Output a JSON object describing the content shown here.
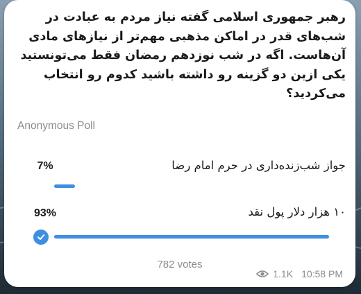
{
  "question": "رهبر جمهوری اسلامی گفته نیاز مردم به عبادت در شب‌های قدر در اماکن مذهبی مهم‌تر از نیازهای مادی آن‌هاست. اگه در شب نوزدهم رمضان فقط می‌تونستید یکی ازین دو گزینه رو داشته باشید کدوم رو انتخاب می‌کردید؟",
  "poll_type": "Anonymous Poll",
  "options": [
    {
      "percent": "7%",
      "text": "جواز شب‌زنده‌داری در حرم امام رضا",
      "fraction": 0.07,
      "chosen": false
    },
    {
      "percent": "93%",
      "text": "۱۰ هزار دلار پول نقد",
      "fraction": 0.93,
      "chosen": true
    }
  ],
  "votes": "782 votes",
  "views": "1.1K",
  "time": "10:58 PM",
  "colors": {
    "accent": "#3e8fe0",
    "muted": "#8c8c8c"
  },
  "icons": {
    "views": "eye-icon",
    "chosen": "check-circle-icon"
  }
}
